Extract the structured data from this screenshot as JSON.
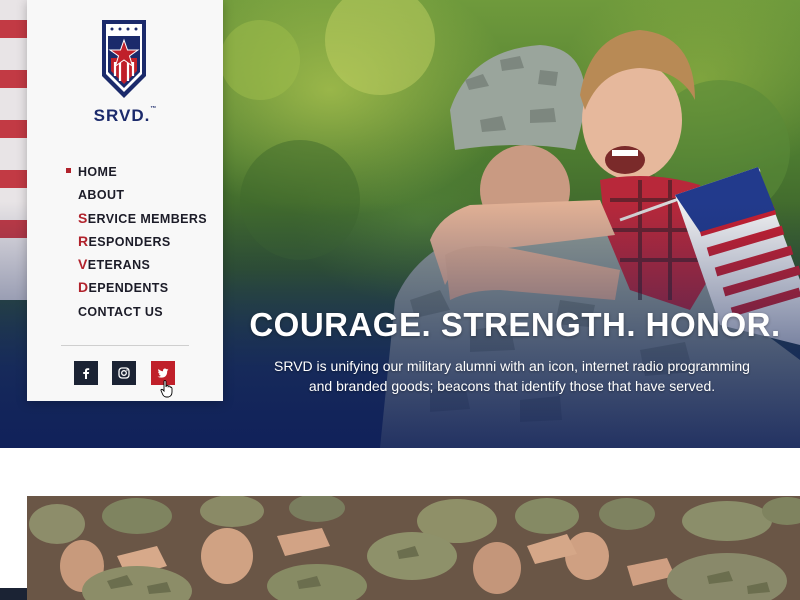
{
  "brand": {
    "name": "SRVD.",
    "tm": "™"
  },
  "nav": {
    "items": [
      {
        "first": "",
        "rest": "HOME",
        "active": true
      },
      {
        "first": "",
        "rest": "ABOUT",
        "active": false
      },
      {
        "first": "S",
        "rest": "ERVICE MEMBERS",
        "active": false
      },
      {
        "first": "R",
        "rest": "ESPONDERS",
        "active": false
      },
      {
        "first": "V",
        "rest": "ETERANS",
        "active": false
      },
      {
        "first": "D",
        "rest": "EPENDENTS",
        "active": false
      },
      {
        "first": "",
        "rest": "CONTACT US",
        "active": false
      }
    ]
  },
  "social": [
    {
      "icon": "facebook-icon"
    },
    {
      "icon": "instagram-icon"
    },
    {
      "icon": "twitter-icon"
    }
  ],
  "hero": {
    "headline": "COURAGE. STRENGTH. HONOR.",
    "subtext": "SRVD is unifying our military alumni with an icon, internet radio programming and branded goods; beacons that identify those that have served."
  },
  "colors": {
    "navy": "#1b2a6b",
    "red": "#b1222c",
    "panel": "#f8f8f8"
  }
}
